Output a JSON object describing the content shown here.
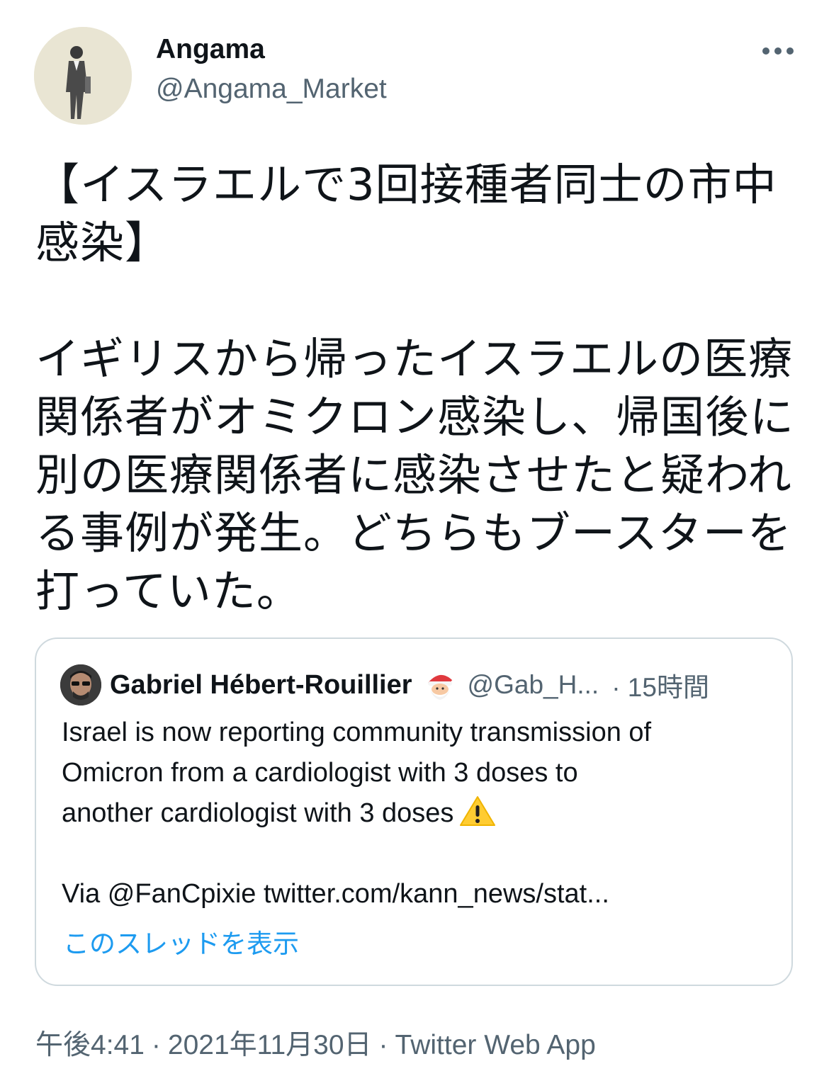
{
  "author": {
    "name": "Angama",
    "handle": "@Angama_Market",
    "avatar_icon": "person-in-suit-avatar"
  },
  "more_icon": "more-horizontal-icon",
  "tweet": {
    "text": "【イスラエルで3回接種者同士の市中\n感染】\n\nイギリスから帰ったイスラエルの医療\n関係者がオミクロン感染し、帰国後に\n別の医療関係者に感染させたと疑われ\nる事例が発生。どちらもブースターを\n打っていた。"
  },
  "quoted_tweet": {
    "author_name": "Gabriel Hébert-Rouillier",
    "author_emoji": "santa-emoji",
    "handle": "@Gab_H...",
    "time": "· 15時間",
    "body_line_1": "Israel is now reporting community transmission of",
    "body_line_2": "Omicron from a cardiologist with 3 doses to",
    "body_line_3": "another cardiologist with 3 doses",
    "warning_icon": "warning-icon",
    "body_line_4": "Via @FanCpixie twitter.com/kann_news/stat...",
    "thread_link": "このスレッドを表示"
  },
  "meta": {
    "time": "午後4:41",
    "separator": "·",
    "date": "2021年11月30日",
    "source": "Twitter Web App"
  },
  "colors": {
    "text": "#0f1419",
    "secondary": "#536471",
    "link": "#1d9bf0",
    "border": "#cfd9de"
  }
}
